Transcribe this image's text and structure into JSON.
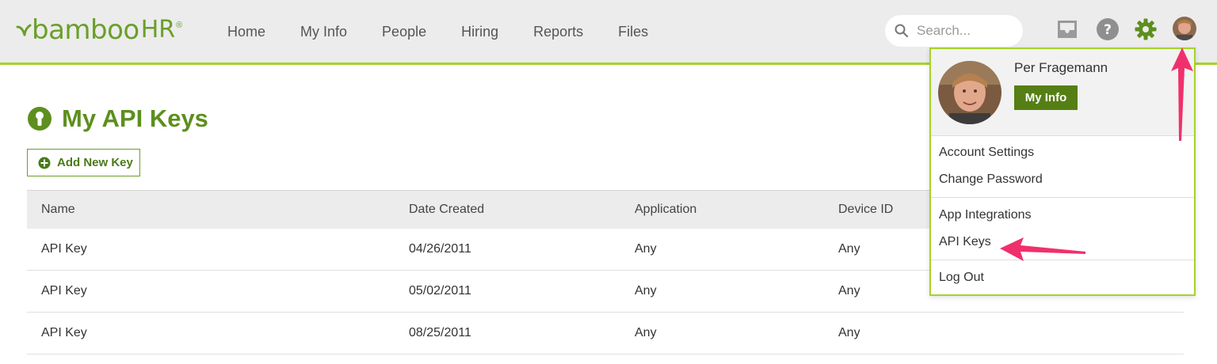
{
  "brand": {
    "logo_text": "bamboo",
    "logo_hr": "HR",
    "logo_reg": "®",
    "accent": "#a6d22b",
    "green": "#5d8f1e"
  },
  "nav": {
    "items": [
      {
        "label": "Home"
      },
      {
        "label": "My Info"
      },
      {
        "label": "People"
      },
      {
        "label": "Hiring"
      },
      {
        "label": "Reports"
      },
      {
        "label": "Files"
      }
    ]
  },
  "search": {
    "placeholder": "Search...",
    "value": ""
  },
  "header_icons": [
    "inbox-icon",
    "help-icon",
    "gear-icon",
    "avatar"
  ],
  "page": {
    "title": "My API Keys",
    "add_button": "Add New Key"
  },
  "table": {
    "columns": [
      "Name",
      "Date Created",
      "Application",
      "Device ID"
    ],
    "rows": [
      [
        "API Key",
        "04/26/2011",
        "Any",
        "Any"
      ],
      [
        "API Key",
        "05/02/2011",
        "Any",
        "Any"
      ],
      [
        "API Key",
        "08/25/2011",
        "Any",
        "Any"
      ]
    ]
  },
  "user_menu": {
    "name": "Per Fragemann",
    "my_info_button": "My Info",
    "items": [
      "Account Settings",
      "Change Password",
      "App Integrations",
      "API Keys",
      "Log Out"
    ]
  },
  "annotation_color": "#f0306c"
}
